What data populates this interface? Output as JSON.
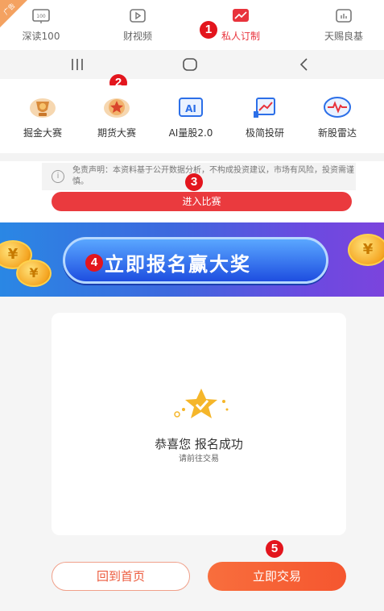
{
  "ad_tag": "广告",
  "tabs": [
    {
      "label": "深读100",
      "icon": "book-icon"
    },
    {
      "label": "财视频",
      "icon": "play-icon"
    },
    {
      "label": "私人订制",
      "icon": "trend-chart-icon",
      "active": true
    },
    {
      "label": "天赐良基",
      "icon": "bar-chart-icon"
    }
  ],
  "features": [
    {
      "label": "掘金大赛",
      "icon": "trophy-icon"
    },
    {
      "label": "期货大赛",
      "icon": "star-medal-icon"
    },
    {
      "label": "AI量股2.0",
      "icon": "ai-icon"
    },
    {
      "label": "极简投研",
      "icon": "trend-board-icon"
    },
    {
      "label": "新股雷达",
      "icon": "radar-pulse-icon"
    }
  ],
  "disclaimer": {
    "text": "免责声明：本资料基于公开数据分析，不构成投资建议，市场有风险，投资需谨慎。",
    "button": "进入比赛"
  },
  "banner": {
    "text": "立即报名赢大奖",
    "coin_symbol": "¥"
  },
  "success": {
    "title": "恭喜您 报名成功",
    "subtitle": "请前往交易"
  },
  "actions": {
    "home": "回到首页",
    "trade": "立即交易"
  },
  "markers": [
    "1",
    "2",
    "3",
    "4",
    "5"
  ],
  "colors": {
    "accent_red": "#e8333c",
    "trade_orange": "#f5562f",
    "banner_blue": "#3d68de"
  }
}
